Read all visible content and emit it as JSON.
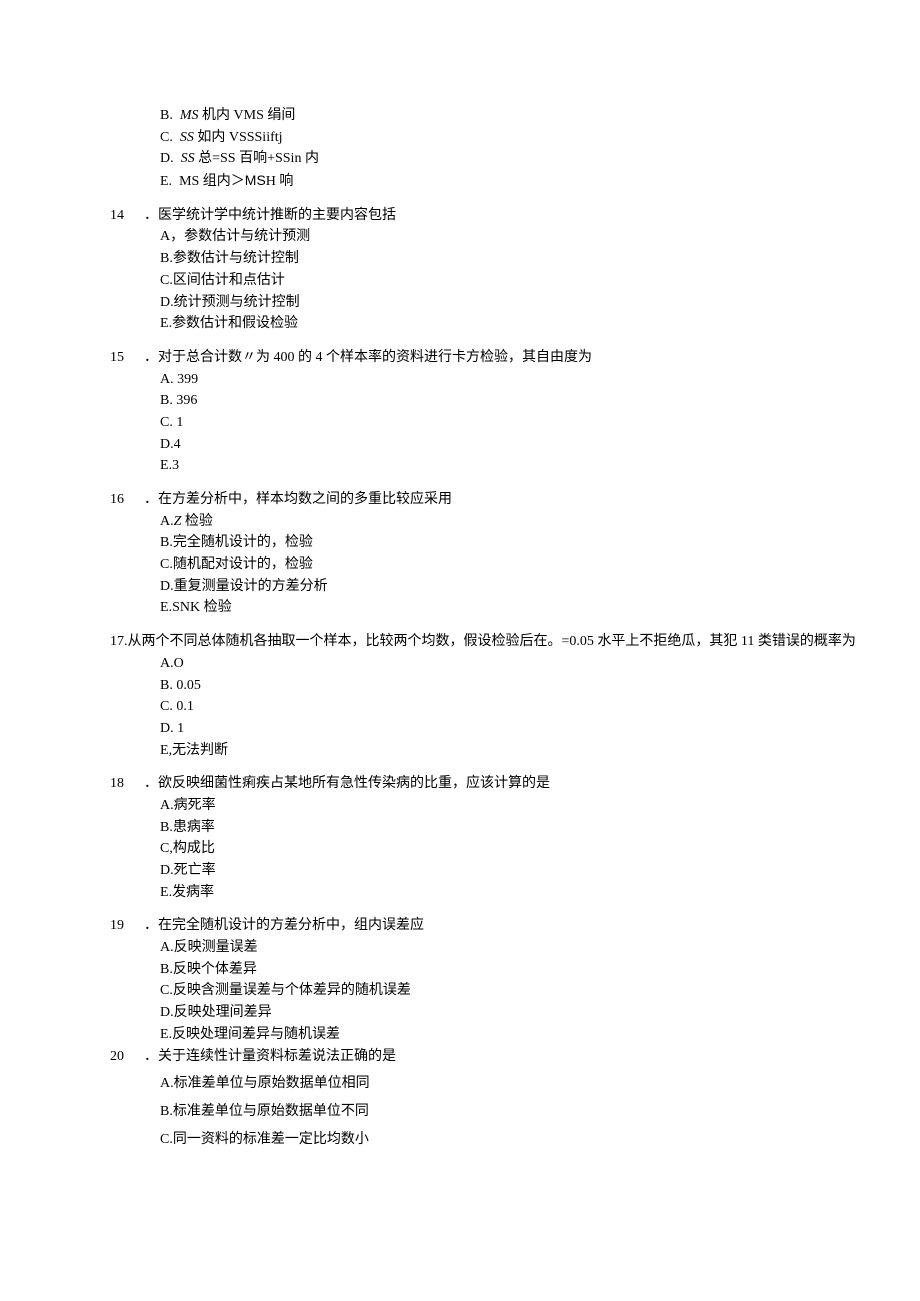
{
  "pre_options": [
    {
      "label": "B.",
      "text_parts": [
        {
          "t": "MS",
          "cls": "italic"
        },
        {
          "t": " 机内 VMS 绢间"
        }
      ]
    },
    {
      "label": "C.",
      "text_parts": [
        {
          "t": "SS",
          "cls": "italic"
        },
        {
          "t": " 如内 VSSSiiftj"
        }
      ]
    },
    {
      "label": "D.",
      "text_parts": [
        {
          "t": "SS",
          "cls": "italic"
        },
        {
          "t": " 总=SS 百响+SSin 内"
        }
      ]
    },
    {
      "label": "E.",
      "text_parts": [
        {
          "t": "MS 组内＞"
        },
        {
          "t": "MS",
          "cls": "sans"
        },
        {
          "t": "H 响"
        }
      ]
    }
  ],
  "questions": [
    {
      "num": "14",
      "stem": "．医学统计学中统计推断的主要内容包括",
      "opts": [
        {
          "label": "A",
          "sep": "，",
          "text": "参数估计与统计预测"
        },
        {
          "label": "B",
          "sep": ".",
          "text": "参数估计与统计控制"
        },
        {
          "label": "C",
          "sep": ".",
          "text": "区间估计和点估计"
        },
        {
          "label": "D",
          "sep": ".",
          "text": "统计预测与统计控制"
        },
        {
          "label": "E",
          "sep": ".",
          "text": "参数估计和假设检验"
        }
      ]
    },
    {
      "num": "15",
      "stem": "．对于总合计数〃为 400 的 4 个样本率的资料进行卡方检验，其自由度为",
      "opts": [
        {
          "label": "A.",
          "sep": "  ",
          "text": "399"
        },
        {
          "label": "B.",
          "sep": "  ",
          "text": "396"
        },
        {
          "label": "C.",
          "sep": "  ",
          "text": "1"
        },
        {
          "label": "D",
          "sep": ".",
          "text": "4"
        },
        {
          "label": "E",
          "sep": ".",
          "text": "3"
        }
      ]
    },
    {
      "num": "16",
      "stem": "．在方差分析中，样本均数之间的多重比较应采用",
      "opts": [
        {
          "label": "A",
          "sep": ".",
          "text_parts": [
            {
              "t": "Z",
              "cls": "italic"
            },
            {
              "t": " 检验"
            }
          ]
        },
        {
          "label": "B",
          "sep": ".",
          "text": "完全随机设计的，检验"
        },
        {
          "label": "C",
          "sep": ".",
          "text": "随机配对设计的，检验"
        },
        {
          "label": "D",
          "sep": ".",
          "text": "重复测量设计的方差分析"
        },
        {
          "label": "E",
          "sep": ".",
          "text": "SNK 检验"
        }
      ]
    },
    {
      "num": "17",
      "stem_full": "17.从两个不同总体随机各抽取一个样本，比较两个均数，假设检验后在。=0.05 水平上不拒绝瓜，其犯 11 类错误的概率为",
      "opts": [
        {
          "label": "A",
          "sep": ".",
          "text": "O"
        },
        {
          "label": "B.",
          "sep": "  ",
          "text": "0.05"
        },
        {
          "label": "C.",
          "sep": "  ",
          "text": "0.1"
        },
        {
          "label": "D.",
          "sep": "  ",
          "text": "1"
        },
        {
          "label": "E",
          "sep": ",",
          "text": "无法判断"
        }
      ]
    },
    {
      "num": "18",
      "stem": "．欲反映细菌性痢疾占某地所有急性传染病的比重，应该计算的是",
      "opts": [
        {
          "label": "A",
          "sep": ".",
          "text": "病死率"
        },
        {
          "label": "B",
          "sep": ".",
          "text": "患病率"
        },
        {
          "label": "C",
          "sep": ",",
          "text": "构成比"
        },
        {
          "label": "D",
          "sep": ".",
          "text": "死亡率"
        },
        {
          "label": "E",
          "sep": ".",
          "text": "发病率"
        }
      ]
    },
    {
      "num": "19",
      "stem": "．在完全随机设计的方差分析中，组内误差应",
      "opts": [
        {
          "label": "A",
          "sep": ".",
          "text": "反映测量误差"
        },
        {
          "label": "B",
          "sep": ".",
          "text": "反映个体差异"
        },
        {
          "label": "C",
          "sep": ".",
          "text": "反映含测量误差与个体差异的随机误差"
        },
        {
          "label": "D",
          "sep": ".",
          "text": "反映处理间差异"
        },
        {
          "label": "E",
          "sep": ".",
          "text": "反映处理间差异与随机误差"
        }
      ],
      "no_gap_after": true
    },
    {
      "num": "20",
      "stem": "．关于连续性计量资料标差说法正确的是",
      "opts": [
        {
          "label": "A",
          "sep": ".",
          "text": "标准差单位与原始数据单位相同",
          "extra_space": true
        },
        {
          "label": "B",
          "sep": ".",
          "text": "标准差单位与原始数据单位不同",
          "extra_space": true
        },
        {
          "label": "C",
          "sep": ".",
          "text": "同一资料的标准差一定比均数小",
          "extra_space": true
        }
      ]
    }
  ]
}
